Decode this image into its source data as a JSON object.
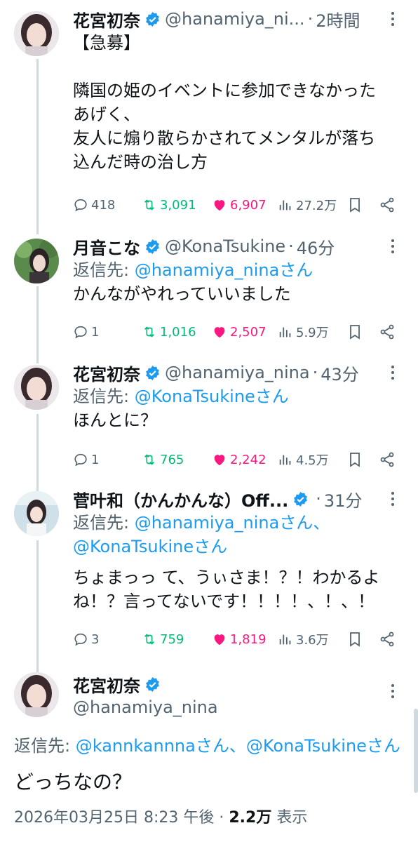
{
  "tweets": [
    {
      "name": "花宮初奈",
      "handle": "@hanamiya_ni...",
      "dot": "·",
      "time": "2時間",
      "text": "【急募】\n\n隣国の姫のイベントに参加できなかった\nあげく、\n友人に煽り散らかされてメンタルが落ち\n込んだ時の治し方",
      "replies": "418",
      "retweets": "3,091",
      "likes": "6,907",
      "views": "27.2万"
    },
    {
      "name": "月音こな",
      "handle": "@KonaTsukine",
      "dot": "·",
      "time": "46分",
      "reply_prefix": "返信先: ",
      "reply_link": "@hanamiya_ninaさん",
      "text": "かんながやれっていいました",
      "replies": "1",
      "retweets": "1,016",
      "likes": "2,507",
      "views": "5.9万"
    },
    {
      "name": "花宮初奈",
      "handle": "@hanamiya_nina",
      "dot": "·",
      "time": "43分",
      "reply_prefix": "返信先: ",
      "reply_link": "@KonaTsukineさん",
      "text": "ほんとに？",
      "replies": "1",
      "retweets": "765",
      "likes": "2,242",
      "views": "4.5万"
    },
    {
      "name": "菅叶和（かんかんな）Off...",
      "handle": "",
      "dot": "·",
      "time": "31分",
      "reply_prefix": "返信先: ",
      "reply_link": "@hanamiya_ninaさん、",
      "reply_link2": "@KonaTsukineさん",
      "text": "ちょまっっ て、うぃさま！？！わかるよ\nね！？言ってないです！！！！、！、！",
      "replies": "3",
      "retweets": "759",
      "likes": "1,819",
      "views": "3.6万"
    }
  ],
  "main_tweet": {
    "name": "花宮初奈",
    "handle": "@hanamiya_nina",
    "reply_prefix": "返信先: ",
    "reply_link": "@kannkannnaさん、@KonaTsukineさん",
    "text": "どっちなの？",
    "timestamp": "2026年03月25日 8:23 午後 · ",
    "views_count": "2.2万",
    "views_label": " 表示"
  },
  "icons": {
    "verified": "verified-badge-icon",
    "reply": "reply-icon",
    "retweet": "retweet-icon",
    "like": "heart-icon",
    "views": "views-icon",
    "bookmark": "bookmark-icon",
    "share": "share-icon",
    "more": "more-vertical-icon"
  },
  "colors": {
    "accent": "#1d9bf0",
    "retweet": "#00ba7c",
    "like": "#f91880",
    "secondary_text": "#536471"
  }
}
